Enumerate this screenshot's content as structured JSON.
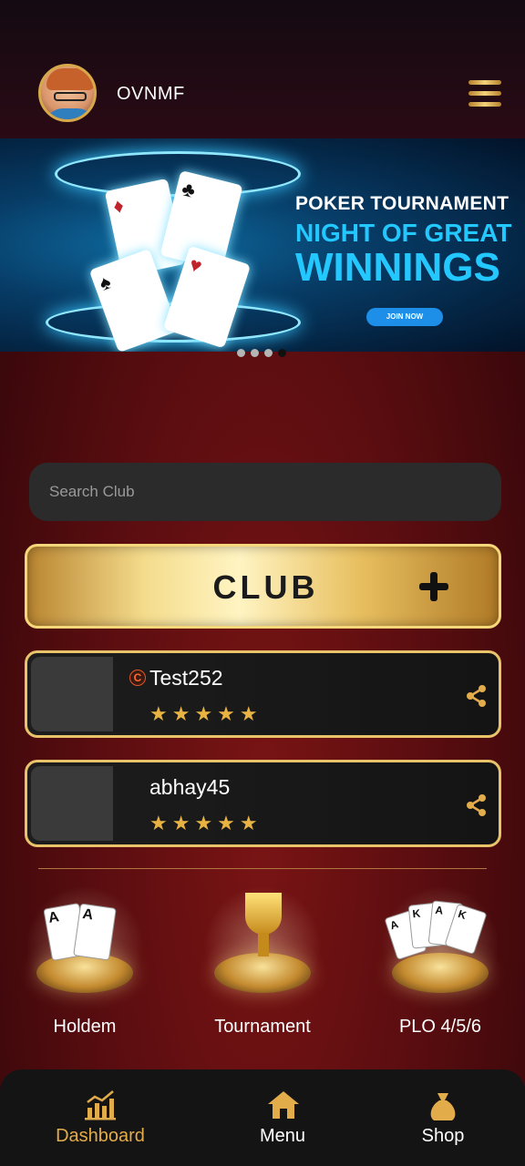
{
  "header": {
    "username": "OVNMF",
    "avatar_icon": "avatar-icon",
    "menu_icon": "hamburger-menu-icon"
  },
  "banner": {
    "line1": "POKER TOURNAMENT",
    "line2": "NIGHT OF GREAT",
    "line3": "WINNINGS",
    "button_label": "JOIN NOW",
    "slides_total": 4,
    "active_slide": 4
  },
  "search": {
    "placeholder": "Search Club",
    "value": ""
  },
  "club_button": {
    "label": "CLUB",
    "icon": "plus-icon"
  },
  "clubs": [
    {
      "name": "Test252",
      "badge": "C",
      "rating": 5,
      "stars": "★★★★★",
      "share_icon": "share-icon"
    },
    {
      "name": "abhay45",
      "badge": "",
      "rating": 5,
      "stars": "★★★★★",
      "share_icon": "share-icon"
    }
  ],
  "games": [
    {
      "label": "Holdem",
      "icon": "holdem-cards-icon"
    },
    {
      "label": "Tournament",
      "icon": "trophy-icon"
    },
    {
      "label": "PLO 4/5/6",
      "icon": "plo-cards-icon"
    }
  ],
  "nav": [
    {
      "label": "Dashboard",
      "icon": "chart-icon",
      "active": true
    },
    {
      "label": "Menu",
      "icon": "home-icon",
      "active": false
    },
    {
      "label": "Shop",
      "icon": "bag-icon",
      "active": false
    }
  ],
  "colors": {
    "gold": "#e2ac4b",
    "background": "#5a0d10",
    "banner_accent": "#22c8ff"
  }
}
